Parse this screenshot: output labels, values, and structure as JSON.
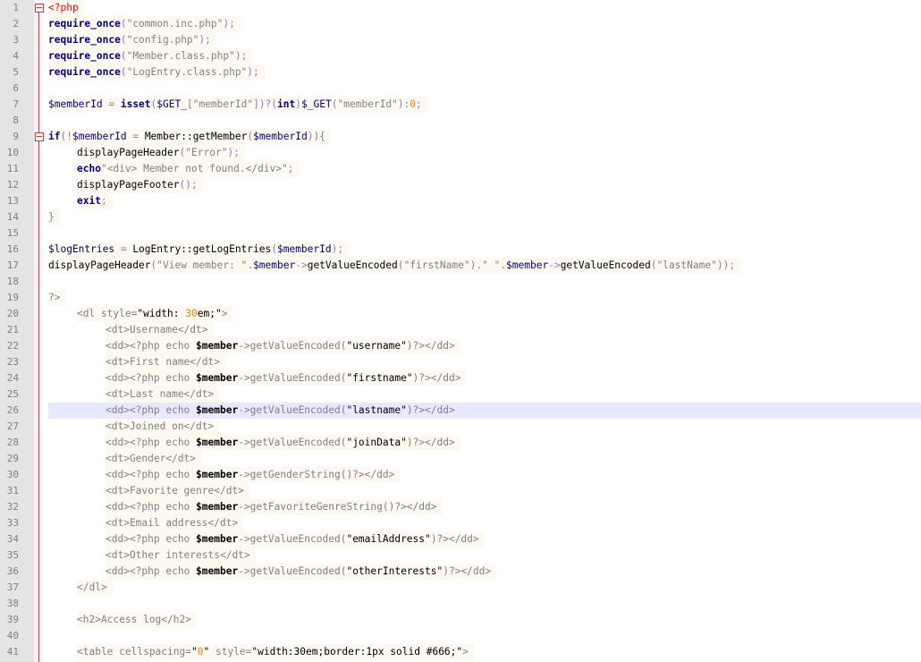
{
  "editor": {
    "current_line": 26,
    "fold_markers": [
      1,
      9
    ],
    "lines": [
      {
        "n": "1",
        "indent": 0,
        "tokens": [
          {
            "t": "<?php",
            "c": "phpopen"
          }
        ]
      },
      {
        "n": "2",
        "indent": 0,
        "tokens": [
          {
            "t": "require_once",
            "c": "kw"
          },
          {
            "t": "(",
            "c": "op"
          },
          {
            "t": "\"common.inc.php\"",
            "c": "str"
          },
          {
            "t": ");",
            "c": "op"
          }
        ]
      },
      {
        "n": "3",
        "indent": 0,
        "tokens": [
          {
            "t": "require_once",
            "c": "kw"
          },
          {
            "t": "(",
            "c": "op"
          },
          {
            "t": "\"config.php\"",
            "c": "str"
          },
          {
            "t": ");",
            "c": "op"
          }
        ]
      },
      {
        "n": "4",
        "indent": 0,
        "tokens": [
          {
            "t": "require_once",
            "c": "kw"
          },
          {
            "t": "(",
            "c": "op"
          },
          {
            "t": "\"Member.class.php\"",
            "c": "str"
          },
          {
            "t": ");",
            "c": "op"
          }
        ]
      },
      {
        "n": "5",
        "indent": 0,
        "tokens": [
          {
            "t": "require_once",
            "c": "kw"
          },
          {
            "t": "(",
            "c": "op"
          },
          {
            "t": "\"LogEntry.class.php\"",
            "c": "str"
          },
          {
            "t": ");",
            "c": "op"
          }
        ]
      },
      {
        "n": "6",
        "indent": 0,
        "tokens": []
      },
      {
        "n": "7",
        "indent": 0,
        "tokens": [
          {
            "t": "$memberId",
            "c": "var"
          },
          {
            "t": " = ",
            "c": "op"
          },
          {
            "t": "isset",
            "c": "kw"
          },
          {
            "t": "(",
            "c": "op"
          },
          {
            "t": "$GET_",
            "c": "var"
          },
          {
            "t": "[",
            "c": "op"
          },
          {
            "t": "\"memberId\"",
            "c": "str"
          },
          {
            "t": "])?(",
            "c": "op"
          },
          {
            "t": "int",
            "c": "kw"
          },
          {
            "t": ")",
            "c": "op"
          },
          {
            "t": "$_GET",
            "c": "var"
          },
          {
            "t": "(",
            "c": "op"
          },
          {
            "t": "\"memberId\"",
            "c": "str"
          },
          {
            "t": "):",
            "c": "op"
          },
          {
            "t": "0",
            "c": "num"
          },
          {
            "t": ";",
            "c": "op"
          }
        ]
      },
      {
        "n": "8",
        "indent": 0,
        "tokens": []
      },
      {
        "n": "9",
        "indent": 0,
        "tokens": [
          {
            "t": "if",
            "c": "kw"
          },
          {
            "t": "(!",
            "c": "op"
          },
          {
            "t": "$memberId",
            "c": "var"
          },
          {
            "t": " = ",
            "c": "op"
          },
          {
            "t": "Member::getMember",
            "c": "fn"
          },
          {
            "t": "(",
            "c": "op"
          },
          {
            "t": "$memberId",
            "c": "var"
          },
          {
            "t": ")){",
            "c": "op"
          }
        ]
      },
      {
        "n": "10",
        "indent": 1,
        "tokens": [
          {
            "t": "displayPageHeader",
            "c": "fn"
          },
          {
            "t": "(",
            "c": "op"
          },
          {
            "t": "\"Error\"",
            "c": "str"
          },
          {
            "t": ");",
            "c": "op"
          }
        ]
      },
      {
        "n": "11",
        "indent": 1,
        "tokens": [
          {
            "t": "echo",
            "c": "kw"
          },
          {
            "t": "\"<div> Member not found.</div>\"",
            "c": "str"
          },
          {
            "t": ";",
            "c": "op"
          }
        ]
      },
      {
        "n": "12",
        "indent": 1,
        "tokens": [
          {
            "t": "displayPageFooter",
            "c": "fn"
          },
          {
            "t": "();",
            "c": "op"
          }
        ]
      },
      {
        "n": "13",
        "indent": 1,
        "tokens": [
          {
            "t": "exit",
            "c": "kw"
          },
          {
            "t": ";",
            "c": "op"
          }
        ]
      },
      {
        "n": "14",
        "indent": 0,
        "tokens": [
          {
            "t": "}",
            "c": "op"
          }
        ]
      },
      {
        "n": "15",
        "indent": 0,
        "tokens": []
      },
      {
        "n": "16",
        "indent": 0,
        "tokens": [
          {
            "t": "$logEntries",
            "c": "var"
          },
          {
            "t": " = ",
            "c": "op"
          },
          {
            "t": "LogEntry::getLogEntries",
            "c": "fn"
          },
          {
            "t": "(",
            "c": "op"
          },
          {
            "t": "$memberId",
            "c": "var"
          },
          {
            "t": ");",
            "c": "op"
          }
        ]
      },
      {
        "n": "17",
        "indent": 0,
        "tokens": [
          {
            "t": "displayPageHeader",
            "c": "fn"
          },
          {
            "t": "(",
            "c": "op"
          },
          {
            "t": "\"View member: \"",
            "c": "str"
          },
          {
            "t": ".",
            "c": "op"
          },
          {
            "t": "$member",
            "c": "var"
          },
          {
            "t": "->",
            "c": "op"
          },
          {
            "t": "getValueEncoded",
            "c": "fn"
          },
          {
            "t": "(",
            "c": "op"
          },
          {
            "t": "\"firstName\"",
            "c": "str"
          },
          {
            "t": ").",
            "c": "op"
          },
          {
            "t": "\" \"",
            "c": "str"
          },
          {
            "t": ".",
            "c": "op"
          },
          {
            "t": "$member",
            "c": "var"
          },
          {
            "t": "->",
            "c": "op"
          },
          {
            "t": "getValueEncoded",
            "c": "fn"
          },
          {
            "t": "(",
            "c": "op"
          },
          {
            "t": "\"lastName\"",
            "c": "str"
          },
          {
            "t": "));",
            "c": "op"
          }
        ]
      },
      {
        "n": "18",
        "indent": 0,
        "tokens": []
      },
      {
        "n": "19",
        "indent": 0,
        "tokens": [
          {
            "t": "?>",
            "c": "phpclose"
          }
        ]
      },
      {
        "n": "20",
        "indent": 1,
        "tokens": [
          {
            "t": "<dl style=",
            "c": "tag"
          },
          {
            "t": "\"width: ",
            "c": "dark"
          },
          {
            "t": "30",
            "c": "num"
          },
          {
            "t": "em;\"",
            "c": "dark"
          },
          {
            "t": ">",
            "c": "tag"
          }
        ]
      },
      {
        "n": "21",
        "indent": 2,
        "tokens": [
          {
            "t": "<dt>Username</dt>",
            "c": "tag"
          }
        ]
      },
      {
        "n": "22",
        "indent": 2,
        "tokens": [
          {
            "t": "<dd><?php echo ",
            "c": "tag"
          },
          {
            "t": "$member",
            "c": "dark bold"
          },
          {
            "t": "->getValueEncoded(",
            "c": "tag"
          },
          {
            "t": "\"username\"",
            "c": "dark"
          },
          {
            "t": ")?></dd>",
            "c": "tag"
          }
        ]
      },
      {
        "n": "23",
        "indent": 2,
        "tokens": [
          {
            "t": "<dt>First name</dt>",
            "c": "tag"
          }
        ]
      },
      {
        "n": "24",
        "indent": 2,
        "tokens": [
          {
            "t": "<dd><?php echo ",
            "c": "tag"
          },
          {
            "t": "$member",
            "c": "dark bold"
          },
          {
            "t": "->getValueEncoded(",
            "c": "tag"
          },
          {
            "t": "\"firstname\"",
            "c": "dark"
          },
          {
            "t": ")?></dd>",
            "c": "tag"
          }
        ]
      },
      {
        "n": "25",
        "indent": 2,
        "tokens": [
          {
            "t": "<dt>Last name</dt>",
            "c": "tag"
          }
        ]
      },
      {
        "n": "26",
        "indent": 2,
        "tokens": [
          {
            "t": "<dd><?php echo ",
            "c": "tag"
          },
          {
            "t": "$member",
            "c": "dark bold"
          },
          {
            "t": "->getValueEncoded(",
            "c": "tag"
          },
          {
            "t": "\"lastname\"",
            "c": "dark"
          },
          {
            "t": ")?></dd>",
            "c": "tag"
          }
        ]
      },
      {
        "n": "27",
        "indent": 2,
        "tokens": [
          {
            "t": "<dt>Joined on</dt>",
            "c": "tag"
          }
        ]
      },
      {
        "n": "28",
        "indent": 2,
        "tokens": [
          {
            "t": "<dd><?php echo ",
            "c": "tag"
          },
          {
            "t": "$member",
            "c": "dark bold"
          },
          {
            "t": "->getValueEncoded(",
            "c": "tag"
          },
          {
            "t": "\"joinData\"",
            "c": "dark"
          },
          {
            "t": ")?></dd>",
            "c": "tag"
          }
        ]
      },
      {
        "n": "29",
        "indent": 2,
        "tokens": [
          {
            "t": "<dt>Gender</dt>",
            "c": "tag"
          }
        ]
      },
      {
        "n": "30",
        "indent": 2,
        "tokens": [
          {
            "t": "<dd><?php echo ",
            "c": "tag"
          },
          {
            "t": "$member",
            "c": "dark bold"
          },
          {
            "t": "->getGenderString()?></dd>",
            "c": "tag"
          }
        ]
      },
      {
        "n": "31",
        "indent": 2,
        "tokens": [
          {
            "t": "<dt>Favorite genre</dt>",
            "c": "tag"
          }
        ]
      },
      {
        "n": "32",
        "indent": 2,
        "tokens": [
          {
            "t": "<dd><?php echo ",
            "c": "tag"
          },
          {
            "t": "$member",
            "c": "dark bold"
          },
          {
            "t": "->getFavoriteGenreString()?></dd>",
            "c": "tag"
          }
        ]
      },
      {
        "n": "33",
        "indent": 2,
        "tokens": [
          {
            "t": "<dt>Email address</dt>",
            "c": "tag"
          }
        ]
      },
      {
        "n": "34",
        "indent": 2,
        "tokens": [
          {
            "t": "<dd><?php echo ",
            "c": "tag"
          },
          {
            "t": "$member",
            "c": "dark bold"
          },
          {
            "t": "->getValueEncoded(",
            "c": "tag"
          },
          {
            "t": "\"emailAddress\"",
            "c": "dark"
          },
          {
            "t": ")?></dd>",
            "c": "tag"
          }
        ]
      },
      {
        "n": "35",
        "indent": 2,
        "tokens": [
          {
            "t": "<dt>Other interests</dt>",
            "c": "tag"
          }
        ]
      },
      {
        "n": "36",
        "indent": 2,
        "tokens": [
          {
            "t": "<dd><?php echo ",
            "c": "tag"
          },
          {
            "t": "$member",
            "c": "dark bold"
          },
          {
            "t": "->getValueEncoded(",
            "c": "tag"
          },
          {
            "t": "\"otherInterests\"",
            "c": "dark"
          },
          {
            "t": ")?></dd>",
            "c": "tag"
          }
        ]
      },
      {
        "n": "37",
        "indent": 1,
        "tokens": [
          {
            "t": "</dl>",
            "c": "tag"
          }
        ]
      },
      {
        "n": "38",
        "indent": 0,
        "tokens": []
      },
      {
        "n": "39",
        "indent": 1,
        "tokens": [
          {
            "t": "<h2>Access log</h2>",
            "c": "tag"
          }
        ]
      },
      {
        "n": "40",
        "indent": 0,
        "tokens": []
      },
      {
        "n": "41",
        "indent": 1,
        "tokens": [
          {
            "t": "<table cellspacing=",
            "c": "tag"
          },
          {
            "t": "\"",
            "c": "dark"
          },
          {
            "t": "0",
            "c": "num"
          },
          {
            "t": "\"",
            "c": "dark"
          },
          {
            "t": " style=",
            "c": "tag"
          },
          {
            "t": "\"width:30em;border:1px solid #666;\"",
            "c": "dark"
          },
          {
            "t": ">",
            "c": "tag"
          }
        ]
      }
    ]
  },
  "colors": {
    "fold_marker": "#e03030",
    "current_line_bg": "#e8e8ff",
    "gutter_bg": "#e4e4e4",
    "keyword": "#000080",
    "string": "#808080",
    "number": "#ff8000",
    "php_open": "#ff0000"
  },
  "icons": {
    "fold": "fold-minus-icon"
  }
}
